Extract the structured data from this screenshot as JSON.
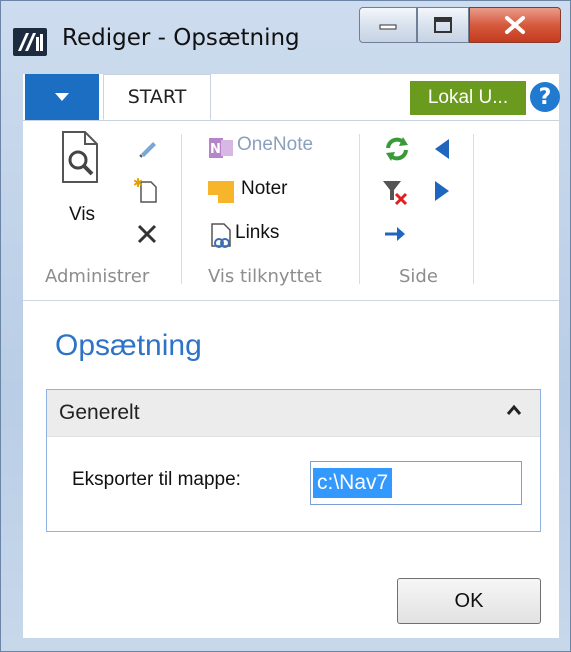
{
  "window": {
    "title": "Rediger - Opsætning"
  },
  "ribbon": {
    "tab_start": "START",
    "company_badge": "Lokal U...",
    "help_label": "?",
    "groups": {
      "administrer": {
        "label": "Administrer",
        "vis_label": "Vis"
      },
      "vis_tilknyttet": {
        "label": "Vis tilknyttet",
        "onenote_label": "OneNote",
        "noter_label": "Noter",
        "links_label": "Links"
      },
      "side": {
        "label": "Side"
      }
    }
  },
  "page": {
    "title": "Opsætning",
    "fasttab": {
      "title": "Generelt",
      "field_label": "Eksporter til mappe:",
      "field_value": "c:\\Nav7"
    },
    "ok_label": "OK"
  },
  "colors": {
    "accent": "#2e73c5",
    "app_menu": "#1b6ec2",
    "company_badge": "#6a9a1e",
    "selection": "#3399ff"
  }
}
